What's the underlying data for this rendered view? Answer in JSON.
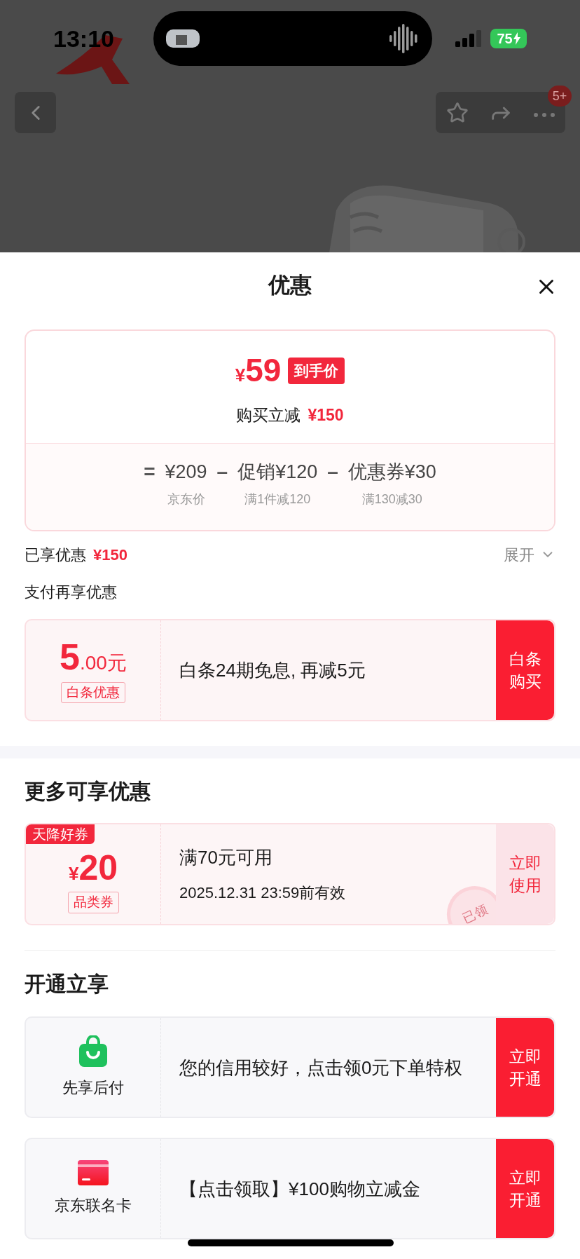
{
  "status_bar": {
    "time": "13:10",
    "battery": "75",
    "charging": true
  },
  "nav": {
    "badge": "5+"
  },
  "sheet": {
    "title": "优惠",
    "price_card": {
      "currency": "¥",
      "price": "59",
      "price_tag": "到手价",
      "saving_label": "购买立减",
      "saving": "¥150",
      "terms": [
        {
          "sign": "=",
          "value": "¥209",
          "note": "京东价"
        },
        {
          "sign": "–",
          "value": "促销¥120",
          "note": "满1件减120"
        },
        {
          "sign": "–",
          "value": "优惠券¥30",
          "note": "满130减30"
        }
      ]
    },
    "enjoyed": {
      "label": "已享优惠",
      "amount": "¥150",
      "toggle": "展开",
      "expanded": false
    },
    "pay_section": {
      "title": "支付再享优惠",
      "offers": [
        {
          "amount": "5",
          "decimals": ".00元",
          "tag": "白条优惠",
          "text": "白条24期免息, 再减5元",
          "action": "白条购买",
          "filled": true
        }
      ]
    },
    "more_section": {
      "title": "更多可享优惠",
      "coupons": [
        {
          "ribbon": "天降好券",
          "currency": "¥",
          "amount": "20",
          "tag": "品类券",
          "condition": "满70元可用",
          "validity": "2025.12.31 23:59前有效",
          "stamp": "已领",
          "action": "立即使用",
          "filled": false
        }
      ]
    },
    "open_section": {
      "title": "开通立享",
      "services": [
        {
          "kind": "bag",
          "name": "先享后付",
          "text": "您的信用较好，点击领0元下单特权",
          "action": "立即开通",
          "filled": true
        },
        {
          "kind": "card",
          "name": "京东联名卡",
          "text": "【点击领取】¥100购物立减金",
          "action": "立即开通",
          "filled": true
        }
      ]
    }
  }
}
